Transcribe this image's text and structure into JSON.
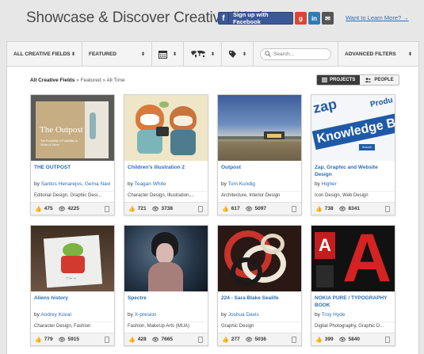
{
  "header": {
    "headline": "Showcase & Discover Creative Work:",
    "facebook_label": "Sign up with Facebook",
    "facebook_icon": "f",
    "google_icon": "g",
    "linkedin_icon": "in",
    "email_icon": "✉",
    "learn_more": "Want to Learn More? →"
  },
  "filters": {
    "creative_fields": "ALL CREATIVE FIELDS",
    "sort": "FEATURED",
    "search_placeholder": "Search...",
    "advanced": "ADVANCED FILTERS"
  },
  "breadcrumb": {
    "part1": "All Creative Fields",
    "sep1": "»",
    "part2": "Featured",
    "sep2": "»",
    "part3": "All Time"
  },
  "view_toggle": {
    "projects": "PROJECTS",
    "people": "PEOPLE"
  },
  "projects": [
    {
      "title": "THE OUTPOST",
      "by": "by",
      "author": "Santos Henarejos, Gema Navi",
      "fields": "Editorial Design, Graphic Desi...",
      "appreciations": "475",
      "views": "4225"
    },
    {
      "title": "Children's illustration 2",
      "by": "by",
      "author": "Teagan White",
      "fields": "Character Design, Illustration,...",
      "appreciations": "721",
      "views": "3738"
    },
    {
      "title": "Outpost",
      "by": "by",
      "author": "Tom Kundig",
      "fields": "Architecture, Interior Design",
      "appreciations": "617",
      "views": "5097"
    },
    {
      "title": "Zap. Graphic and Website Design",
      "by": "by",
      "author": "Higher",
      "fields": "Icon Design, Web Design",
      "appreciations": "738",
      "views": "8341"
    },
    {
      "title": "Aliens history",
      "by": "by",
      "author": "Andrey Koval",
      "fields": "Character Design, Fashion",
      "appreciations": "779",
      "views": "5915"
    },
    {
      "title": "Spectre",
      "by": "by",
      "author": "X-presion",
      "fields": "Fashion, MakeUp Arts (MUA)",
      "appreciations": "428",
      "views": "7665"
    },
    {
      "title": "224 - Sara Blake Sealife",
      "by": "by",
      "author": "Joshua Davis",
      "fields": "Graphic Design",
      "appreciations": "277",
      "views": "5036"
    },
    {
      "title": "NOKIA PURE / TYPOGRAPHY BOOK",
      "by": "by",
      "author": "Troy Hyde",
      "fields": "Digital Photography, Graphic D...",
      "appreciations": "399",
      "views": "5840"
    }
  ],
  "thumb_text": {
    "outpost_title": "The Outpost",
    "outpost_sub": "The Possibility of Possibility or Vision of Vision",
    "zap_logo": "zap",
    "zap_banner": "Knowledge B",
    "zap_tag": "Search",
    "zap_corner": "Produ",
    "alien_letters": "⊤⊢⊣"
  },
  "icons": {
    "appreciate": "👍",
    "views": "👁",
    "calendar": "calendar-icon",
    "globe": "globe-icon",
    "tag": "tag-icon",
    "search": "search-icon"
  }
}
